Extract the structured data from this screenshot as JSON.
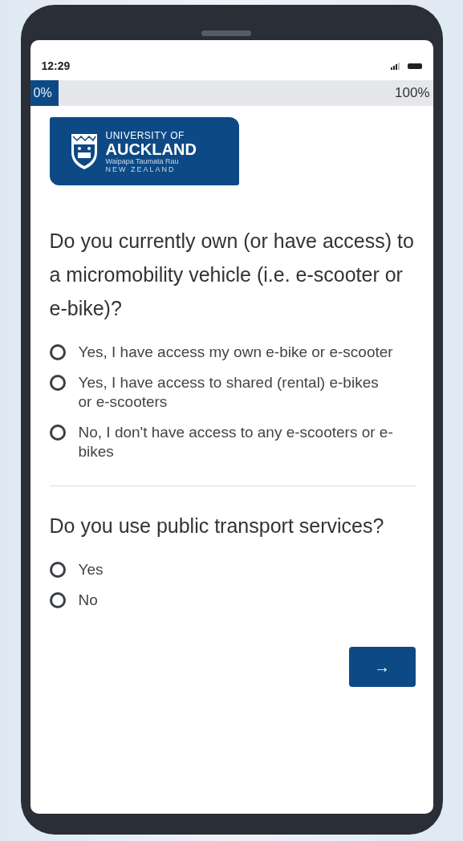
{
  "status_bar": {
    "time": "12:29"
  },
  "progress": {
    "start_label": "0%",
    "end_label": "100%",
    "level": 0
  },
  "logo": {
    "line_1": "UNIVERSITY OF",
    "line_2": "AUCKLAND",
    "line_3": "Waipapa Taumata Rau",
    "line_4": "NEW ZEALAND"
  },
  "questions": [
    {
      "text": "Do you currently own (or have access) to a micromobility vehicle (i.e. e-scooter or e-bike)?",
      "options": [
        {
          "label": "Yes, I have access my own e-bike or e-scooter",
          "selected": false
        },
        {
          "label": "Yes, I have access to shared (rental) e-bikes or e-scooters",
          "selected": false
        },
        {
          "label": "No, I don't have access to any e-scooters or e-bikes",
          "selected": false
        }
      ]
    },
    {
      "text": "Do you use public transport services?",
      "options": [
        {
          "label": "Yes",
          "selected": false
        },
        {
          "label": "No",
          "selected": false
        }
      ]
    }
  ],
  "next_button": {
    "label": "→"
  }
}
